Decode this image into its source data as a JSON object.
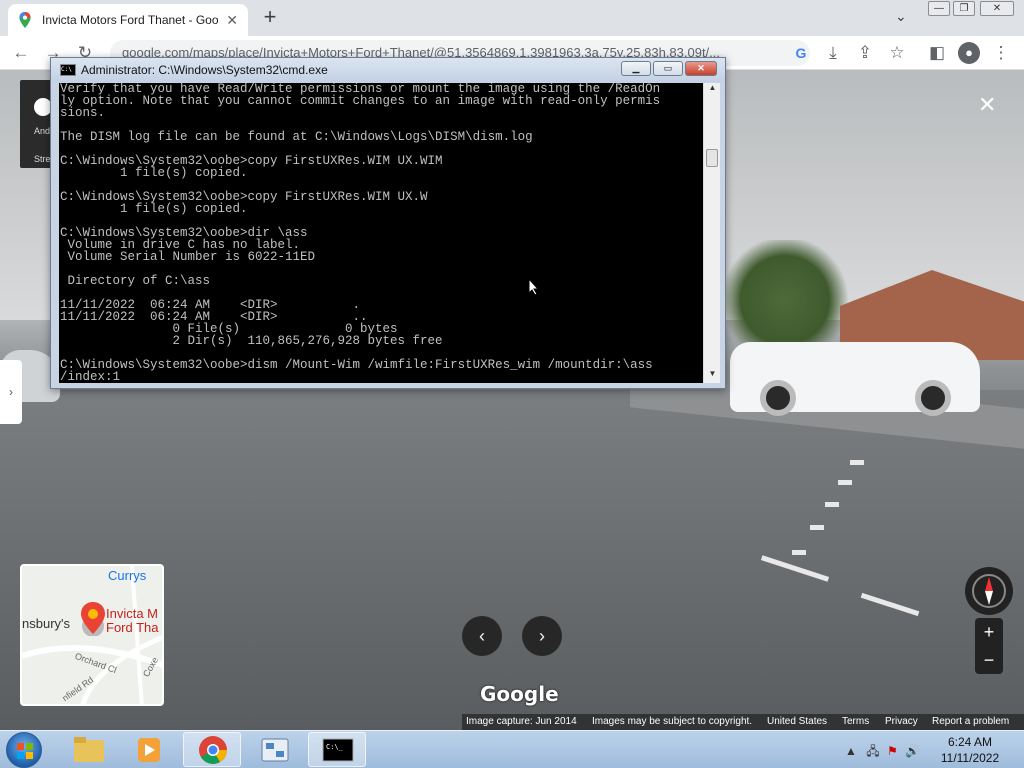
{
  "browser": {
    "tab_title": "Invicta Motors Ford Thanet - Goo",
    "new_tab": "+",
    "url": "google.com/maps/place/Invicta+Motors+Ford+Thanet/@51.3564869,1.3981963,3a,75y,25.83h,83.09t/...",
    "window_minimize": "—",
    "window_restore": "❐",
    "window_close": "✕"
  },
  "cmd": {
    "title": "Administrator: C:\\Windows\\System32\\cmd.exe",
    "lines": "Verify that you have Read/Write permissions or mount the image using the /ReadOn\nly option. Note that you cannot commit changes to an image with read-only permis\nsions.\n\nThe DISM log file can be found at C:\\Windows\\Logs\\DISM\\dism.log\n\nC:\\Windows\\System32\\oobe>copy FirstUXRes.WIM UX.WIM\n        1 file(s) copied.\n\nC:\\Windows\\System32\\oobe>copy FirstUXRes.WIM UX.W\n        1 file(s) copied.\n\nC:\\Windows\\System32\\oobe>dir \\ass\n Volume in drive C has no label.\n Volume Serial Number is 6022-11ED\n\n Directory of C:\\ass\n\n11/11/2022  06:24 AM    <DIR>          .\n11/11/2022  06:24 AM    <DIR>          ..\n               0 File(s)              0 bytes\n               2 Dir(s)  110,865,276,928 bytes free\n\nC:\\Windows\\System32\\oobe>dism /Mount-Wim /wimfile:FirstUXRes_wim /mountdir:\\ass\n/index:1"
  },
  "streetview": {
    "close": "✕",
    "prev": "‹",
    "next": "›",
    "zoom_in": "+",
    "zoom_out": "−",
    "logo": "Google",
    "footer": {
      "capture": "Image capture: Jun 2014",
      "copyright": "Images may be subject to copyright.",
      "country": "United States",
      "terms": "Terms",
      "privacy": "Privacy",
      "report": "Report a problem"
    },
    "minimap": {
      "currys": "Currys",
      "place1": "Invicta M",
      "place2": "Ford Tha",
      "sainsburys": "nsbury's",
      "road1": "Orchard Cl",
      "road2": "nfield Rd",
      "road3": "Coxe"
    },
    "infocard_line1": "And",
    "infocard_line2": "Stre"
  },
  "taskbar": {
    "time": "6:24 AM",
    "date": "11/11/2022"
  },
  "colors": {
    "chrome_tabbar": "#dee1e6",
    "cmd_bg": "#000000",
    "cmd_text": "#c0c0c0",
    "taskbar": "#a9c3e0"
  }
}
